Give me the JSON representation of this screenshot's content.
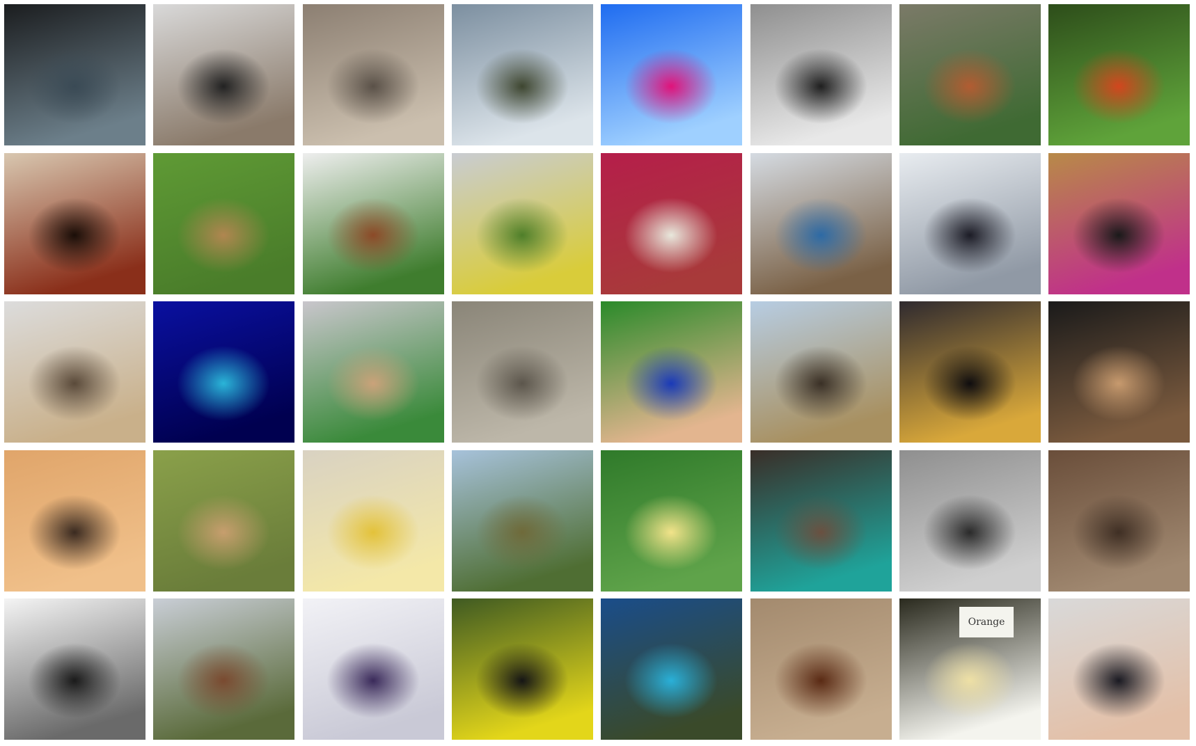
{
  "grid": {
    "background": "#ffffff",
    "rows": 5,
    "cols": 8,
    "tiles": [
      {
        "id": "dark-indoor-figure",
        "colors": [
          "#1b1d1f",
          "#3a4a55",
          "#6c7f8a"
        ]
      },
      {
        "id": "black-poodle",
        "colors": [
          "#d9d9d9",
          "#222222",
          "#8a7a6a"
        ]
      },
      {
        "id": "rock-on-bark",
        "colors": [
          "#8c7f72",
          "#5a5148",
          "#cbbfae"
        ]
      },
      {
        "id": "mountain-lake",
        "colors": [
          "#7c8fa0",
          "#3e4630",
          "#dce4ea"
        ]
      },
      {
        "id": "beaker-on-blue",
        "colors": [
          "#1f6cf0",
          "#e0137a",
          "#9fd0ff"
        ]
      },
      {
        "id": "escalator-bw",
        "colors": [
          "#8f8f8f",
          "#1f1f1f",
          "#e8e8e8"
        ]
      },
      {
        "id": "red-panda",
        "colors": [
          "#7b7a68",
          "#b25c32",
          "#3f6a33"
        ]
      },
      {
        "id": "ladybug",
        "colors": [
          "#2d4d1a",
          "#d2461e",
          "#5fa33a"
        ]
      },
      {
        "id": "coffee-and-tart",
        "colors": [
          "#d8c7b0",
          "#1a0e08",
          "#8a2f1a"
        ]
      },
      {
        "id": "golden-dog-on-grass",
        "colors": [
          "#5f9a35",
          "#b08650",
          "#4a7d2a"
        ]
      },
      {
        "id": "plated-dish",
        "colors": [
          "#eeeeee",
          "#8c4a28",
          "#3f7d2e"
        ]
      },
      {
        "id": "alpine-meadow",
        "colors": [
          "#c9ccd2",
          "#4f7f2a",
          "#d9cc3a"
        ]
      },
      {
        "id": "white-chair",
        "colors": [
          "#b51e4a",
          "#e8e8dc",
          "#a83a3a"
        ]
      },
      {
        "id": "seabird-over-ocean",
        "colors": [
          "#d5dbe2",
          "#2d6aa5",
          "#7a6146"
        ]
      },
      {
        "id": "steel-bridge",
        "colors": [
          "#e8ecf0",
          "#1c1c26",
          "#9099a5"
        ]
      },
      {
        "id": "ipod-on-wood",
        "colors": [
          "#b88a48",
          "#1a1a1a",
          "#c0308a"
        ]
      },
      {
        "id": "spider-on-white",
        "colors": [
          "#dcdcdc",
          "#5a4a3a",
          "#c9b08a"
        ]
      },
      {
        "id": "blue-scorpion",
        "colors": [
          "#0a10a0",
          "#2ab5d8",
          "#000050"
        ]
      },
      {
        "id": "kitten-on-bag",
        "colors": [
          "#c9c6cc",
          "#caa27a",
          "#3a8a3a"
        ]
      },
      {
        "id": "elephant-calf",
        "colors": [
          "#8a8578",
          "#5c564c",
          "#bdb7a9"
        ]
      },
      {
        "id": "graduates",
        "colors": [
          "#2a8a2a",
          "#1a3ab8",
          "#e3b58f"
        ]
      },
      {
        "id": "sky-ornament",
        "colors": [
          "#b7cde3",
          "#3a3026",
          "#a89060"
        ]
      },
      {
        "id": "suspension-bridge-dusk",
        "colors": [
          "#2f2a2f",
          "#0f0d0f",
          "#d9a83a"
        ]
      },
      {
        "id": "fossil-trilobite",
        "colors": [
          "#1a1a1a",
          "#c79a6e",
          "#7a5a3e"
        ]
      },
      {
        "id": "sewing-machine",
        "colors": [
          "#e0a56a",
          "#3a2a20",
          "#f0c08a"
        ]
      },
      {
        "id": "gazelle",
        "colors": [
          "#8aa04a",
          "#c79e6e",
          "#6a7d3a"
        ]
      },
      {
        "id": "lemon-slice",
        "colors": [
          "#d9d2c2",
          "#e3c23a",
          "#f4e8a8"
        ]
      },
      {
        "id": "viaduct-landscape",
        "colors": [
          "#a7c2db",
          "#6f6a3a",
          "#4f6e33"
        ]
      },
      {
        "id": "cauliflower",
        "colors": [
          "#2f7a2a",
          "#f2e38a",
          "#5fa34a"
        ]
      },
      {
        "id": "library-room",
        "colors": [
          "#3a2e28",
          "#6a5040",
          "#1fa39a"
        ]
      },
      {
        "id": "bw-face-hair",
        "colors": [
          "#8f8f8f",
          "#2a2a2a",
          "#cfcfcf"
        ]
      },
      {
        "id": "rocky-shore",
        "colors": [
          "#6a4e3a",
          "#3f2f24",
          "#a08870"
        ]
      },
      {
        "id": "compass",
        "colors": [
          "#f4f4f4",
          "#1a1a1a",
          "#6a6a6a"
        ]
      },
      {
        "id": "stone-bridge-valley",
        "colors": [
          "#c9ced6",
          "#7a4a30",
          "#5a6a3a"
        ]
      },
      {
        "id": "glass-flask",
        "colors": [
          "#f2f2f6",
          "#3a2a5a",
          "#c9c9d6"
        ]
      },
      {
        "id": "fire-salamander",
        "colors": [
          "#3f5a22",
          "#151515",
          "#e3d61a"
        ]
      },
      {
        "id": "ocean-coast-aerial",
        "colors": [
          "#1a4d8a",
          "#2ab0d8",
          "#3a4a2a"
        ]
      },
      {
        "id": "cockroach-on-sand",
        "colors": [
          "#a38a6e",
          "#5a2a14",
          "#c7ae90"
        ]
      },
      {
        "id": "cauliflower-with-card",
        "colors": [
          "#2a2a1e",
          "#eee0a5",
          "#f4f4ee"
        ]
      },
      {
        "id": "man-holding-phone",
        "colors": [
          "#d9d9d9",
          "#1a1a22",
          "#e3c0a8"
        ]
      }
    ],
    "captions": {
      "card_text": "Orange"
    }
  }
}
